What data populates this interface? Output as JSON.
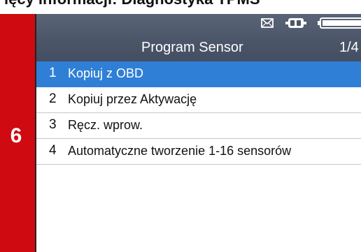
{
  "caption": {
    "text": "ięcy informacji: Diagnostyka TPMS"
  },
  "step_tab": {
    "number": "6",
    "color": "#cf0a10"
  },
  "header": {
    "title": "Program Sensor",
    "page": "1/4",
    "icons": [
      "mail-icon",
      "vehicle-connection-icon",
      "battery-icon"
    ]
  },
  "menu": {
    "selected_color": "#2f7fd6",
    "items": [
      {
        "num": "1",
        "label": "Kopiuj z OBD"
      },
      {
        "num": "2",
        "label": "Kopiuj przez Aktywację"
      },
      {
        "num": "3",
        "label": "Ręcz. wprow."
      },
      {
        "num": "4",
        "label": "Automatyczne tworzenie 1-16 sensorów"
      }
    ]
  }
}
